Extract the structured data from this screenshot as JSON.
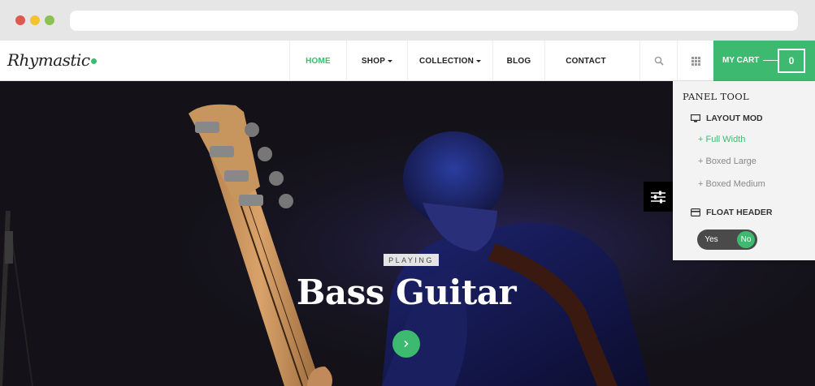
{
  "header": {
    "logo": "Rhymastic",
    "nav": [
      {
        "label": "HOME"
      },
      {
        "label": "SHOP"
      },
      {
        "label": "COLLECTION"
      },
      {
        "label": "BLOG"
      },
      {
        "label": "CONTACT"
      }
    ],
    "search_icon": "search-icon",
    "grid_icon": "grid-menu-icon",
    "cart": {
      "label": "MY CART",
      "count": "0"
    }
  },
  "hero": {
    "tag": "PLAYING",
    "title": "Bass Guitar",
    "next_icon": "chevron-right-icon"
  },
  "panel": {
    "title": "PANEL TOOL",
    "layout_title": "LAYOUT MOD",
    "layout_options": [
      "+ Full Width",
      "+ Boxed Large",
      "+ Boxed Medium"
    ],
    "float_title": "FLOAT HEADER",
    "toggle_yes": "Yes",
    "toggle_no": "No"
  },
  "colors": {
    "accent": "#3dba6f",
    "dark": "#141218"
  }
}
